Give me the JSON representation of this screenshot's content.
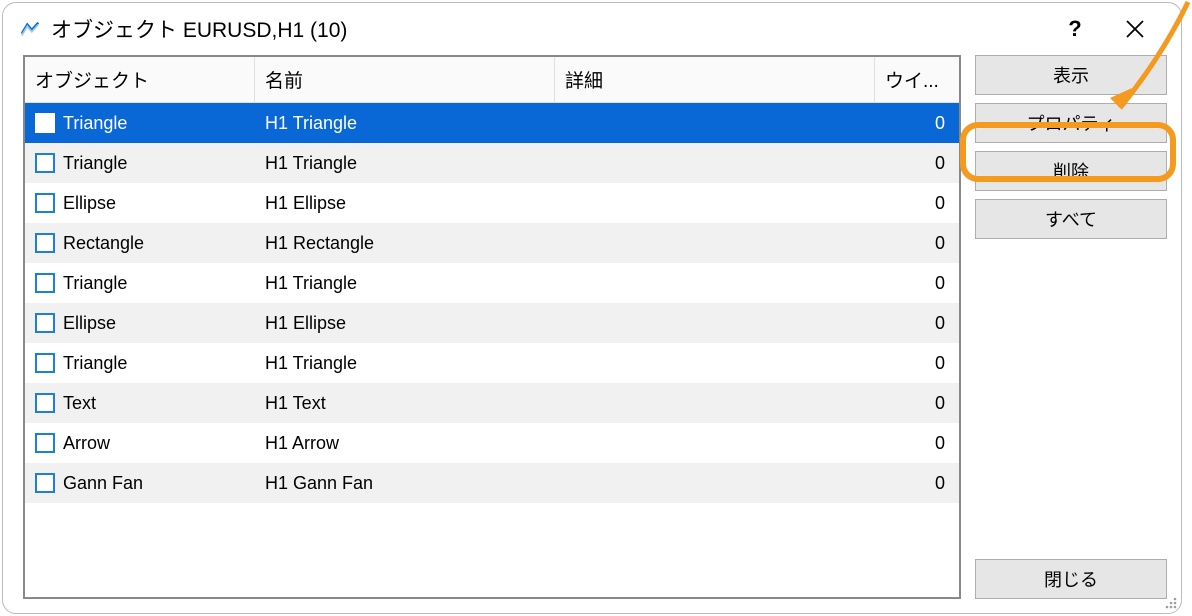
{
  "title": "オブジェクト EURUSD,H1 (10)",
  "help": "?",
  "columns": {
    "object": "オブジェクト",
    "name": "名前",
    "detail": "詳細",
    "wi": "ウイ..."
  },
  "rows": [
    {
      "object": "Triangle",
      "name": "H1 Triangle",
      "detail": "",
      "wi": "0",
      "selected": true
    },
    {
      "object": "Triangle",
      "name": "H1 Triangle",
      "detail": "",
      "wi": "0"
    },
    {
      "object": "Ellipse",
      "name": "H1 Ellipse",
      "detail": "",
      "wi": "0"
    },
    {
      "object": "Rectangle",
      "name": "H1 Rectangle",
      "detail": "",
      "wi": "0"
    },
    {
      "object": "Triangle",
      "name": "H1 Triangle",
      "detail": "",
      "wi": "0"
    },
    {
      "object": "Ellipse",
      "name": "H1 Ellipse",
      "detail": "",
      "wi": "0"
    },
    {
      "object": "Triangle",
      "name": "H1 Triangle",
      "detail": "",
      "wi": "0"
    },
    {
      "object": "Text",
      "name": "H1 Text",
      "detail": "",
      "wi": "0"
    },
    {
      "object": "Arrow",
      "name": "H1 Arrow",
      "detail": "",
      "wi": "0"
    },
    {
      "object": "Gann Fan",
      "name": "H1 Gann Fan",
      "detail": "",
      "wi": "0"
    }
  ],
  "buttons": {
    "show": "表示",
    "properties": "プロパティ",
    "delete": "削除",
    "all": "すべて",
    "close": "閉じる"
  }
}
